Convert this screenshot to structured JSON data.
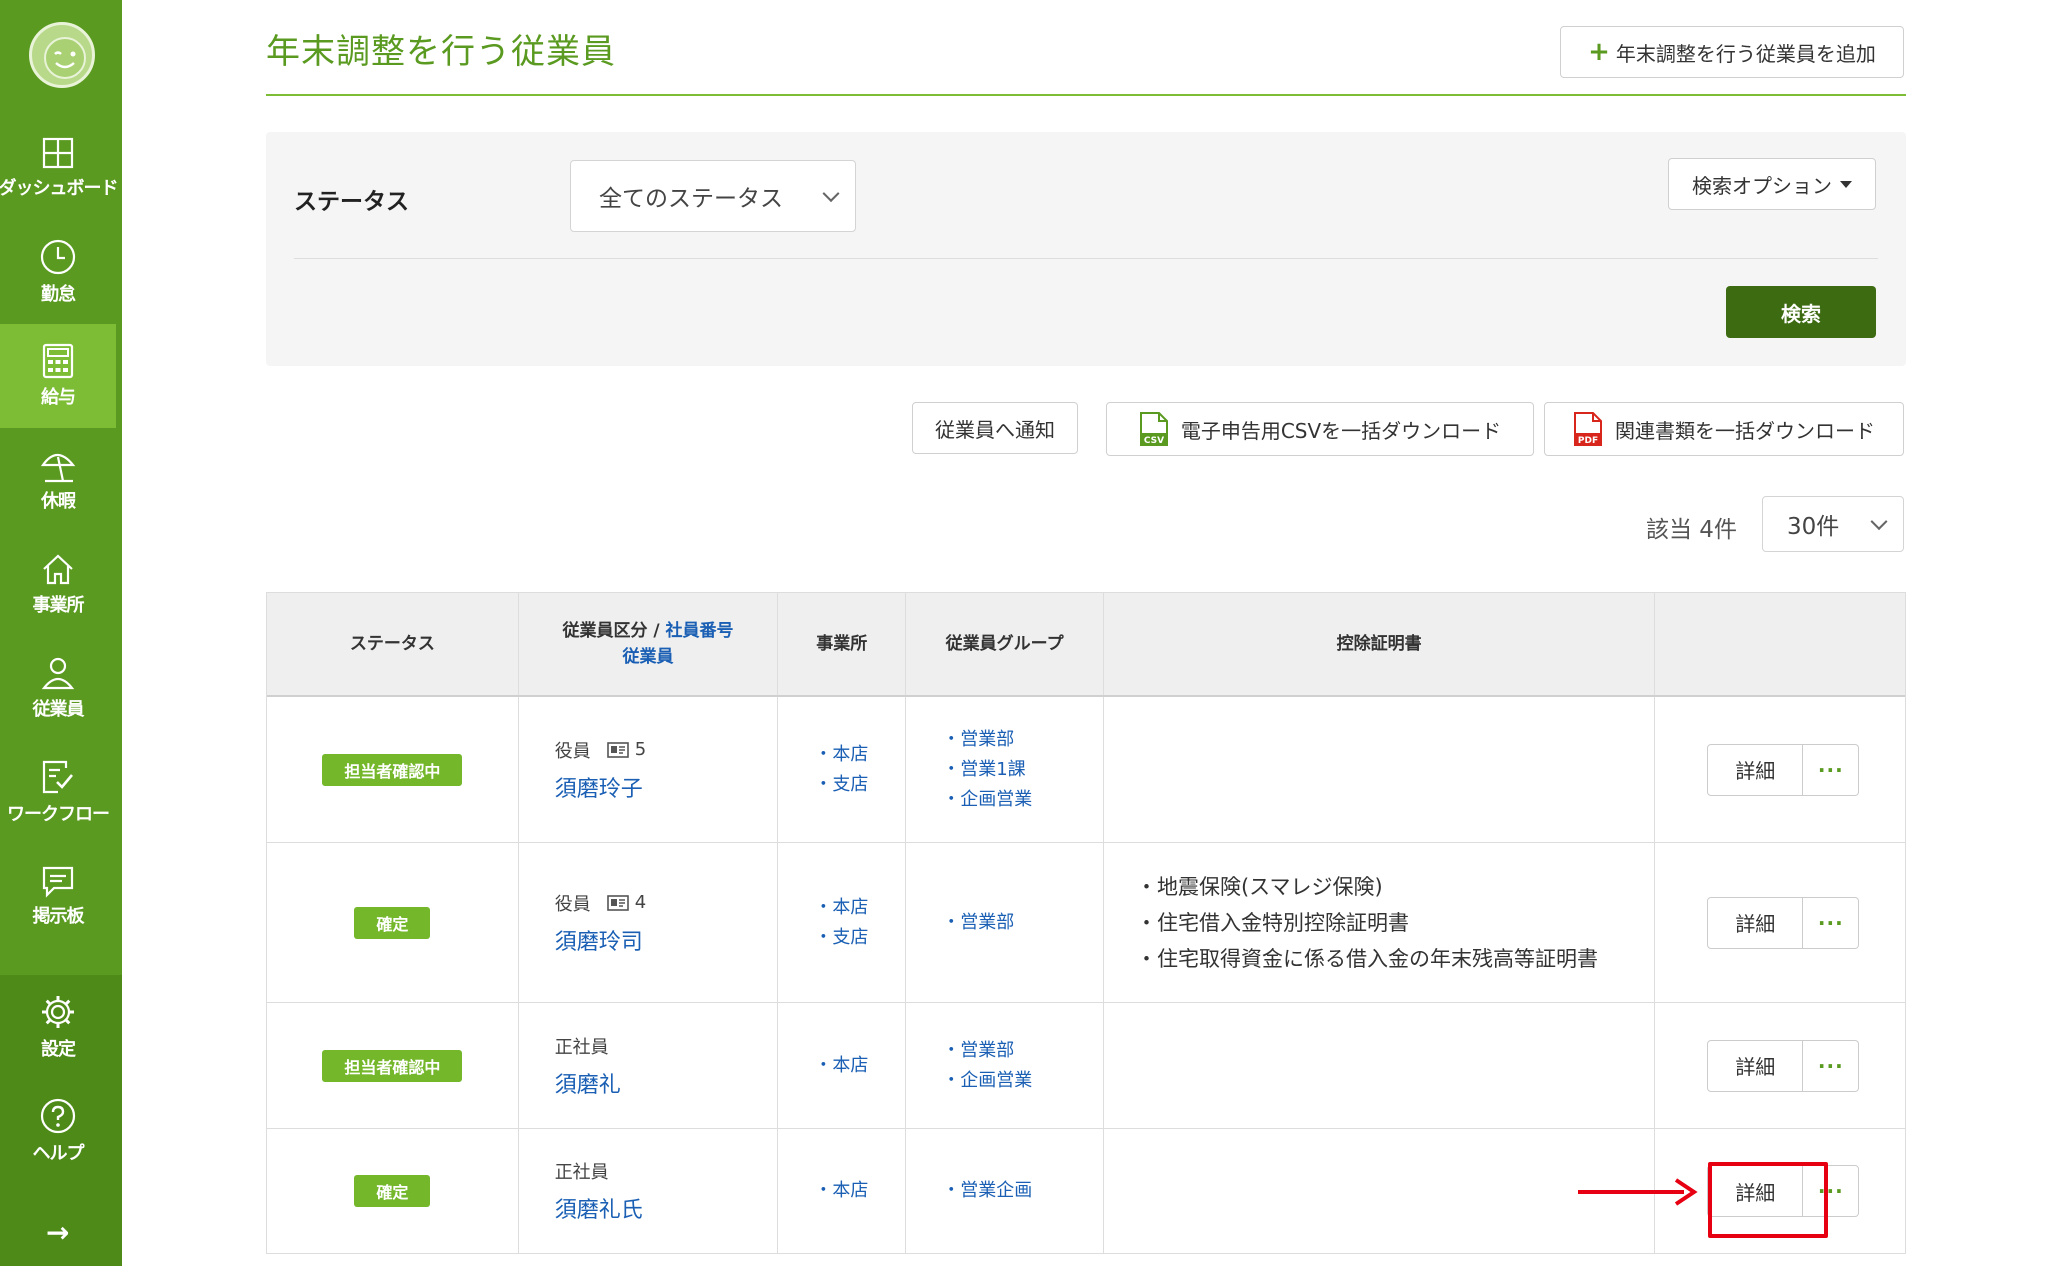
{
  "sidebar": {
    "items": [
      {
        "label": "ダッシュボード",
        "icon": "dashboard-icon"
      },
      {
        "label": "勤怠",
        "icon": "clock-icon"
      },
      {
        "label": "給与",
        "icon": "calculator-icon"
      },
      {
        "label": "休暇",
        "icon": "beach-umbrella-icon"
      },
      {
        "label": "事業所",
        "icon": "home-icon"
      },
      {
        "label": "従業員",
        "icon": "user-icon"
      },
      {
        "label": "ワークフロー",
        "icon": "checklist-icon"
      },
      {
        "label": "掲示板",
        "icon": "message-board-icon"
      }
    ],
    "bottom_items": [
      {
        "label": "設定",
        "icon": "gear-icon"
      },
      {
        "label": "ヘルプ",
        "icon": "help-icon"
      }
    ],
    "expand_icon": "→"
  },
  "page": {
    "title": "年末調整を行う従業員",
    "add_button": "年末調整を行う従業員を追加"
  },
  "search": {
    "status_label": "ステータス",
    "status_value": "全てのステータス",
    "options_button": "検索オプション",
    "search_button": "検索"
  },
  "actions": {
    "notify": "従業員へ通知",
    "csv_download": "電子申告用CSVを一括ダウンロード",
    "pdf_download": "関連書類を一括ダウンロード",
    "csv_icon_text": "CSV",
    "pdf_icon_text": "PDF"
  },
  "results": {
    "count_text": "該当 4件",
    "per_page": "30件"
  },
  "table": {
    "headers": {
      "status": "ステータス",
      "type_prefix": "従業員区分 / ",
      "type_number": "社員番号",
      "type_employee": "従業員",
      "office": "事業所",
      "group": "従業員グループ",
      "certificates": "控除証明書"
    },
    "detail_label": "詳細",
    "more_label": "···",
    "rows": [
      {
        "status": "担当者確認中",
        "type": "役員",
        "number": "5",
        "name": "須磨玲子",
        "offices": [
          "本店",
          "支店"
        ],
        "groups": [
          "営業部",
          "営業1課",
          "企画営業"
        ],
        "certificates": []
      },
      {
        "status": "確定",
        "type": "役員",
        "number": "4",
        "name": "須磨玲司",
        "offices": [
          "本店",
          "支店"
        ],
        "groups": [
          "営業部"
        ],
        "certificates": [
          "地震保険(スマレジ保険)",
          "住宅借入金特別控除証明書",
          "住宅取得資金に係る借入金の年末残高等証明書"
        ]
      },
      {
        "status": "担当者確認中",
        "type": "正社員",
        "number": "",
        "name": "須磨礼",
        "offices": [
          "本店"
        ],
        "groups": [
          "営業部",
          "企画営業"
        ],
        "certificates": []
      },
      {
        "status": "確定",
        "type": "正社員",
        "number": "",
        "name": "須磨礼氏",
        "offices": [
          "本店"
        ],
        "groups": [
          "営業企画"
        ],
        "certificates": []
      }
    ]
  },
  "colors": {
    "brand": "#5a9a20",
    "accent": "#74b72a",
    "link": "#1a5fb4",
    "annotation": "#e60012"
  }
}
